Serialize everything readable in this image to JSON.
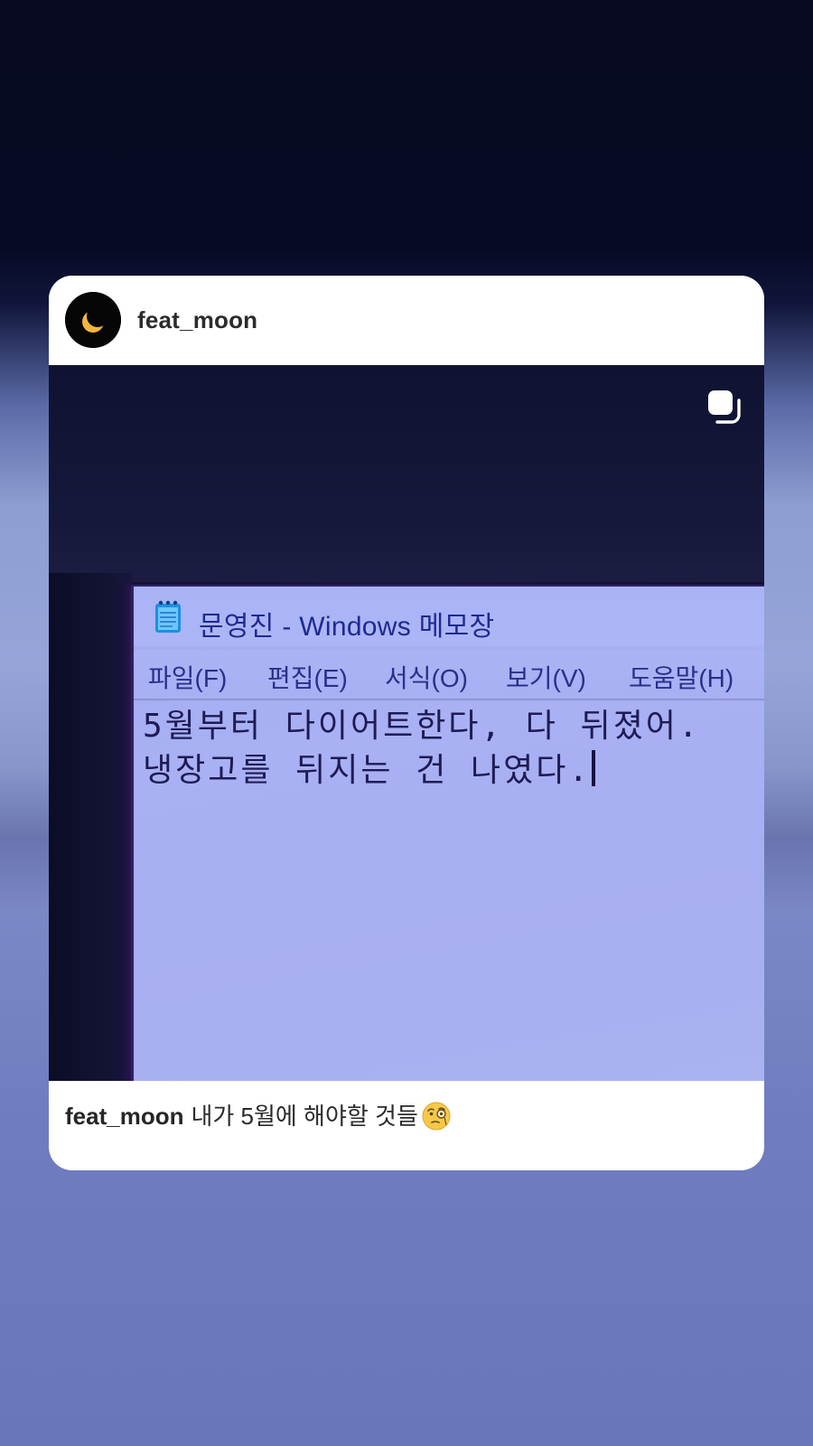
{
  "post": {
    "username": "feat_moon",
    "avatar_icon": "crescent-moon-icon",
    "multi_image_icon": "carousel-icon"
  },
  "photo": {
    "notepad": {
      "title": "문영진 - Windows 메모장",
      "icon": "notepad-icon",
      "menu": [
        "파일(F)",
        "편집(E)",
        "서식(O)",
        "보기(V)",
        "도움말(H)"
      ],
      "lines": [
        "5월부터 다이어트한다, 다 뒤졌어.",
        "냉장고를 뒤지는 건 나였다."
      ]
    }
  },
  "caption": {
    "username": "feat_moon",
    "text": "내가 5월에 해야할 것들",
    "emoji": "face-with-monocle-icon"
  },
  "colors": {
    "background_top": "#070a22",
    "background_bottom": "#6a76ba",
    "card": "#ffffff",
    "notepad_bg": "#a7aef1",
    "notepad_text": "#1e1b55",
    "moon": "#f2b640"
  }
}
